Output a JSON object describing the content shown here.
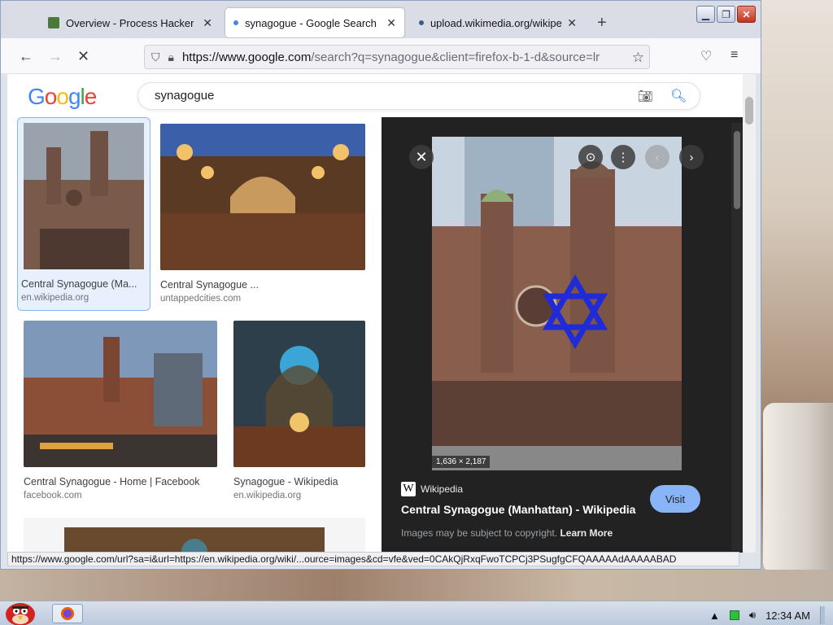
{
  "window": {
    "tabs": [
      {
        "title": "Overview - Process Hacker",
        "active": false
      },
      {
        "title": "synagogue - Google Search",
        "active": true
      },
      {
        "title": "upload.wikimedia.org/wikipe",
        "active": false
      }
    ],
    "new_tab": "+",
    "url_prefix": "https://www.google.com",
    "url_rest": "/search?q=synagogue&client=firefox-b-1-d&source=lr",
    "status_url": "https://www.google.com/url?sa=i&url=https://en.wikipedia.org/wiki/...ource=images&cd=vfe&ved=0CAkQjRxqFwoTCPCj3PSugfgCFQAAAAAdAAAAABAD"
  },
  "google": {
    "logo": "Google",
    "query": "synagogue"
  },
  "results": [
    {
      "title": "Central Synagogue (Ma...",
      "source": "en.wikipedia.org"
    },
    {
      "title": "Central Synagogue ...",
      "source": "untappedcities.com"
    },
    {
      "title": "Central Synagogue - Home | Facebook",
      "source": "facebook.com"
    },
    {
      "title": "Synagogue - Wikipedia",
      "source": "en.wikipedia.org"
    }
  ],
  "preview": {
    "dimensions": "1,636 × 2,187",
    "source": "Wikipedia",
    "title": "Central Synagogue (Manhattan) - Wikipedia",
    "visit": "Visit",
    "copyright": "Images may be subject to copyright.",
    "learn_more": "Learn More"
  },
  "taskbar": {
    "time": "12:34 AM"
  },
  "colors": {
    "google_blue": "#4285F4",
    "google_red": "#EA4335",
    "google_yellow": "#FBBC05",
    "google_green": "#34A853",
    "star_of_david": "#1f2bd6"
  }
}
